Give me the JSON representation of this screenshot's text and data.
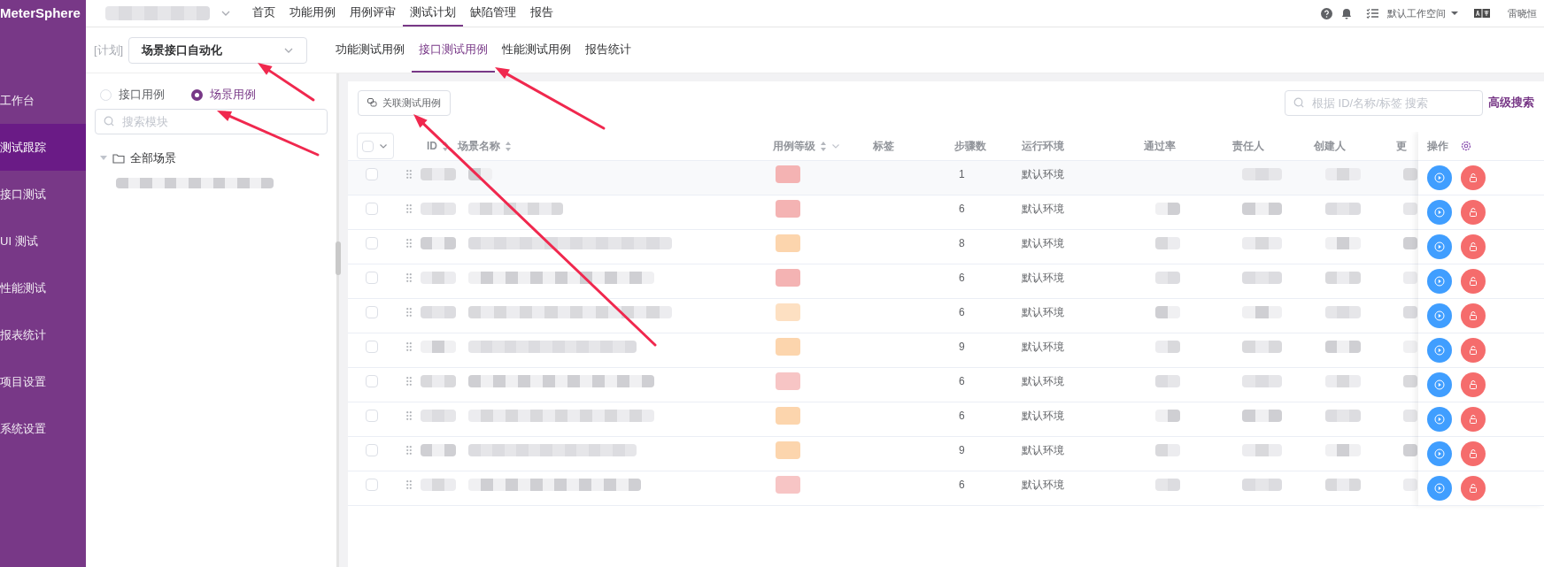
{
  "app": {
    "logo": "MeterSphere"
  },
  "sidebar": {
    "items": [
      {
        "label": "工作台",
        "selected": false
      },
      {
        "label": "测试跟踪",
        "selected": true
      },
      {
        "label": "接口测试",
        "selected": false
      },
      {
        "label": "UI 测试",
        "selected": false
      },
      {
        "label": "性能测试",
        "selected": false
      },
      {
        "label": "报表统计",
        "selected": false
      },
      {
        "label": "项目设置",
        "selected": false
      },
      {
        "label": "系统设置",
        "selected": false
      }
    ]
  },
  "top_nav": {
    "items": [
      {
        "label": "首页",
        "selected": false
      },
      {
        "label": "功能用例",
        "selected": false
      },
      {
        "label": "用例评审",
        "selected": false
      },
      {
        "label": "测试计划",
        "selected": true
      },
      {
        "label": "缺陷管理",
        "selected": false
      },
      {
        "label": "报告",
        "selected": false
      }
    ]
  },
  "header_right": {
    "workspace": "默认工作空间",
    "user": "雷晓恒"
  },
  "plan": {
    "prefix": "[计划]",
    "value": "场景接口自动化"
  },
  "sub_tabs": [
    {
      "label": "功能测试用例",
      "selected": false
    },
    {
      "label": "接口测试用例",
      "selected": true
    },
    {
      "label": "性能测试用例",
      "selected": false
    },
    {
      "label": "报告统计",
      "selected": false
    }
  ],
  "case_type": [
    {
      "label": "接口用例",
      "selected": false
    },
    {
      "label": "场景用例",
      "selected": true
    }
  ],
  "module_search": {
    "placeholder": "搜索模块"
  },
  "tree": [
    {
      "label": "全部场景",
      "expanded": true
    }
  ],
  "toolbar": {
    "link_button": "关联测试用例",
    "search": {
      "placeholder": "根据 ID/名称/标签 搜索"
    },
    "advanced_search": "高级搜索"
  },
  "table": {
    "columns": [
      "ID",
      "场景名称",
      "用例等级",
      "标签",
      "步骤数",
      "运行环境",
      "通过率",
      "责任人",
      "创建人",
      "更"
    ],
    "ops_column": "操作",
    "rows": [
      {
        "checked": false,
        "steps": "1",
        "environment": "默认环境",
        "color": "#f4b3b3",
        "pass_rate_shown": false
      },
      {
        "checked": false,
        "steps": "6",
        "environment": "默认环境",
        "color": "#f4b3b3",
        "pass_rate_shown": true
      },
      {
        "checked": false,
        "steps": "8",
        "environment": "默认环境",
        "color": "#fcd5ad",
        "pass_rate_shown": true
      },
      {
        "checked": false,
        "steps": "6",
        "environment": "默认环境",
        "color": "#f4b3b3",
        "pass_rate_shown": true
      },
      {
        "checked": false,
        "steps": "6",
        "environment": "默认环境",
        "color": "#fde0c2",
        "pass_rate_shown": true
      },
      {
        "checked": false,
        "steps": "9",
        "environment": "默认环境",
        "color": "#fcd5ad",
        "pass_rate_shown": true
      },
      {
        "checked": false,
        "steps": "6",
        "environment": "默认环境",
        "color": "#f7c5c5",
        "pass_rate_shown": true
      },
      {
        "checked": false,
        "steps": "6",
        "environment": "默认环境",
        "color": "#fcd5ad",
        "pass_rate_shown": true
      },
      {
        "checked": false,
        "steps": "9",
        "environment": "默认环境",
        "color": "#fcd5ad",
        "pass_rate_shown": true
      },
      {
        "checked": false,
        "steps": "6",
        "environment": "默认环境",
        "color": "#f7c5c5",
        "pass_rate_shown": true
      }
    ]
  }
}
